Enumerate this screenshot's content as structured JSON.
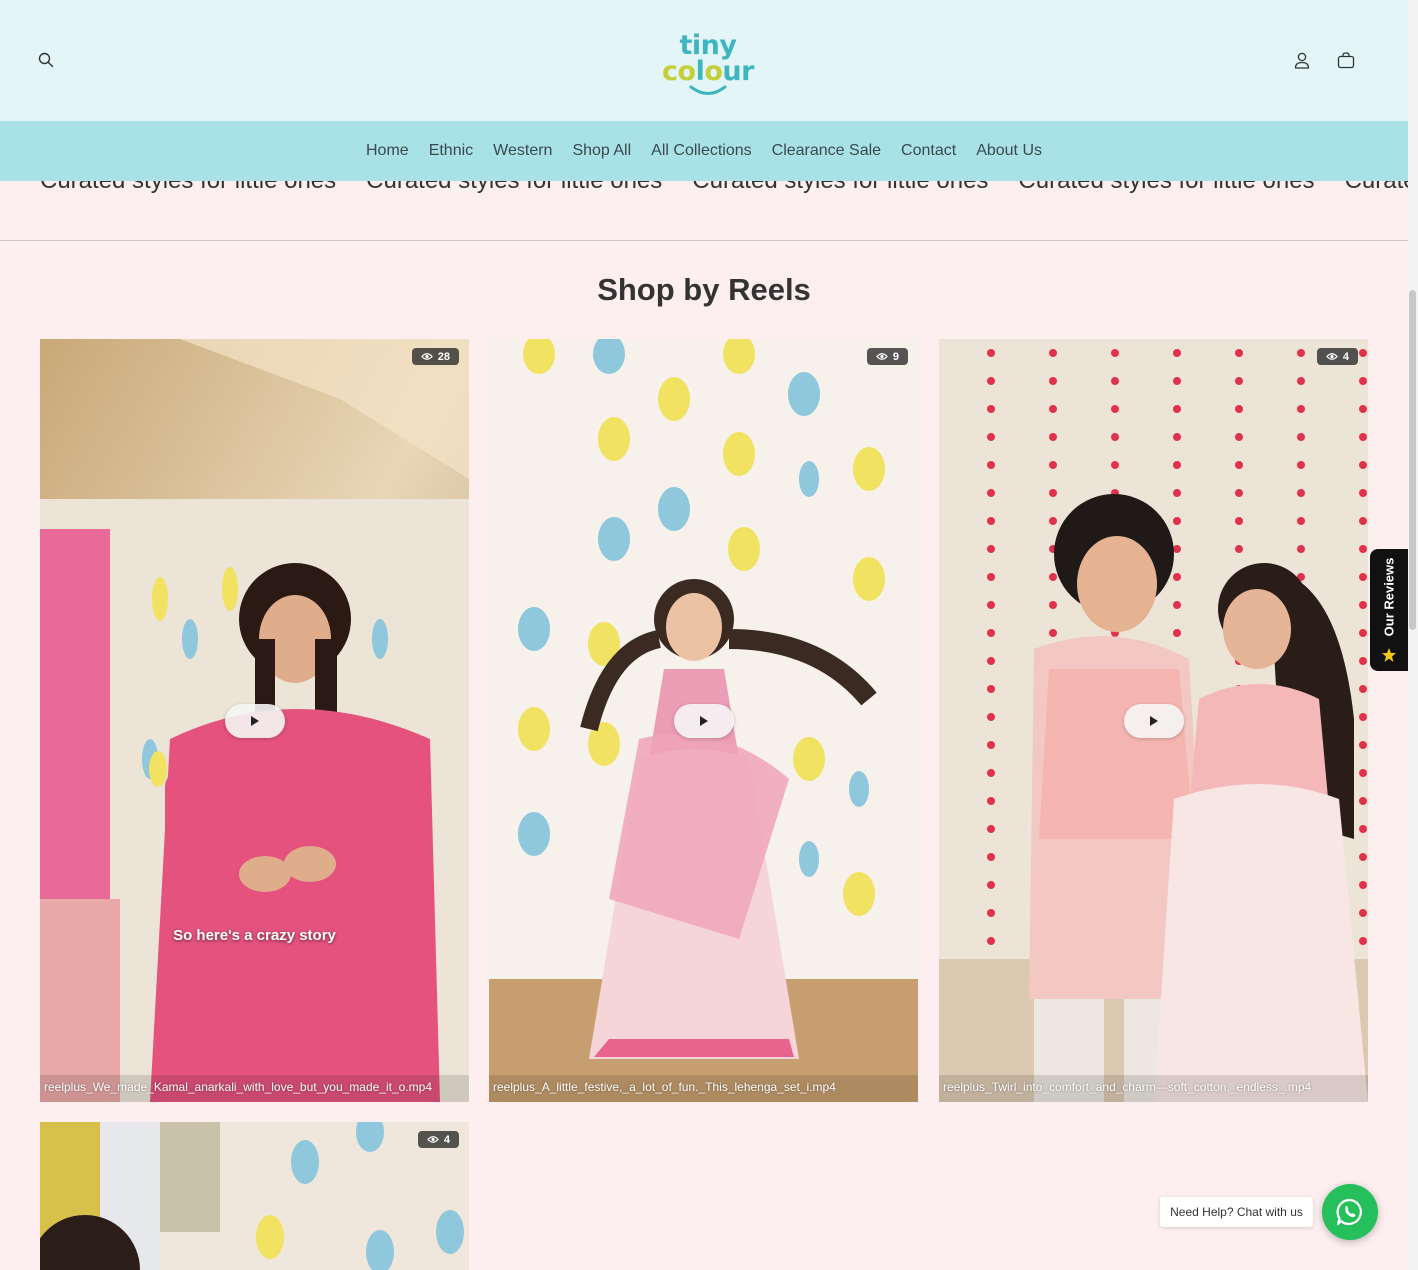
{
  "colors": {
    "header_bg": "#e3f5f7",
    "nav_bg": "#a8e1e6",
    "page_bg": "#fdeef0",
    "logo_teal": "#3fb5bf",
    "logo_lime": "#c5cf3a",
    "whatsapp_green": "#25c05b"
  },
  "header": {
    "search_icon": "search-icon",
    "logo": {
      "line1": "tiny",
      "line2_a": "co",
      "line2_b": "l",
      "line2_c": "o",
      "line2_d": "ur"
    },
    "account_icon": "user-icon",
    "cart_icon": "bag-icon"
  },
  "nav": {
    "items": [
      {
        "label": "Home"
      },
      {
        "label": "Ethnic"
      },
      {
        "label": "Western"
      },
      {
        "label": "Shop All"
      },
      {
        "label": "All Collections"
      },
      {
        "label": "Clearance Sale"
      },
      {
        "label": "Contact"
      },
      {
        "label": "About Us"
      }
    ]
  },
  "marquee": {
    "items": [
      "Curated styles for little ones",
      "Curated styles for little ones",
      "Curated styles for little ones",
      "Curated styles for little ones",
      "Curated styles for little ones"
    ]
  },
  "reels_section": {
    "title": "Shop by Reels",
    "reels": [
      {
        "views": "28",
        "caption": "reelplus_We_made_Kamal_anarkali_with_love_but_you_made_it_o.mp4",
        "overlay": "So here's a crazy story"
      },
      {
        "views": "9",
        "caption": "reelplus_A_little_festive,_a_lot_of_fun._This_lehenga_set_i.mp4"
      },
      {
        "views": "4",
        "caption": "reelplus_Twirl_into_comfort_and_charm—soft_cotton,_endless_.mp4"
      },
      {
        "views": "4",
        "caption": ""
      }
    ]
  },
  "reviews_tab": {
    "label": "Our Reviews",
    "icon": "star-icon"
  },
  "chat": {
    "bubble": "Need Help? Chat with us",
    "icon": "whatsapp-icon"
  }
}
